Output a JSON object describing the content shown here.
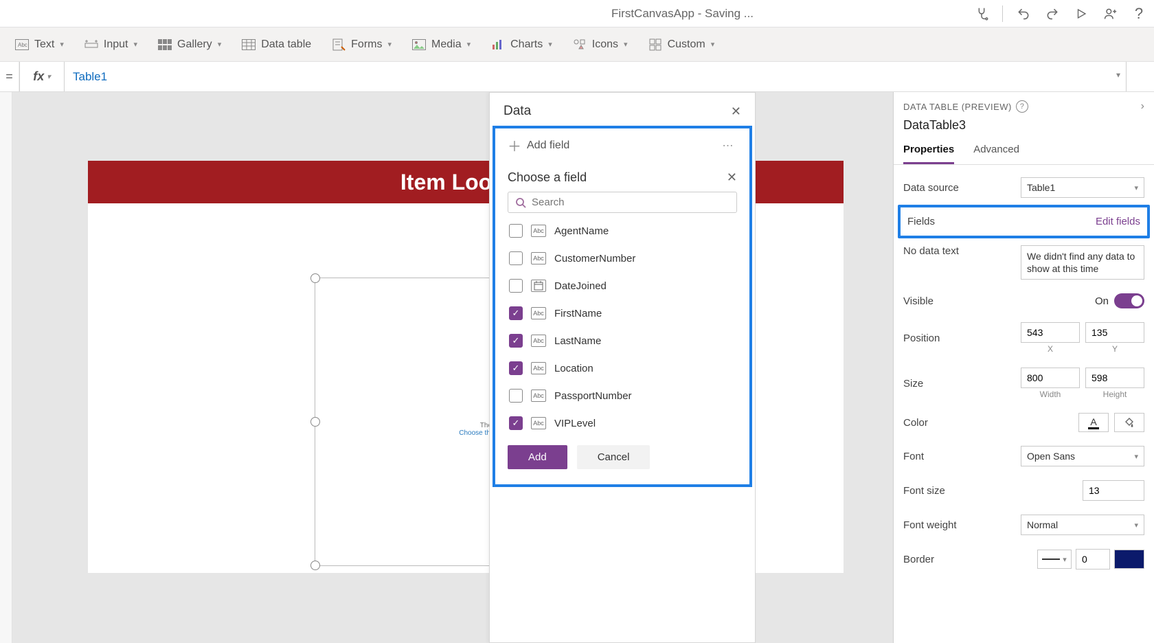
{
  "app": {
    "window_title": "FirstCanvasApp - Saving ..."
  },
  "ribbon": {
    "text": "Text",
    "input": "Input",
    "gallery": "Gallery",
    "datatable": "Data table",
    "forms": "Forms",
    "media": "Media",
    "charts": "Charts",
    "icons": "Icons",
    "custom": "Custom"
  },
  "formula": {
    "value": "Table1"
  },
  "canvas": {
    "header_title": "Item Lookup",
    "empty_line1": "There are no field",
    "empty_line2": "Choose the fields you want to a"
  },
  "data_panel": {
    "title": "Data",
    "add_field": "Add field",
    "choose_title": "Choose a field",
    "search_placeholder": "Search",
    "fields": [
      {
        "name": "AgentName",
        "type": "Abc",
        "checked": false,
        "icon": "abc"
      },
      {
        "name": "CustomerNumber",
        "type": "Abc",
        "checked": false,
        "icon": "abc"
      },
      {
        "name": "DateJoined",
        "type": "Date",
        "checked": false,
        "icon": "date"
      },
      {
        "name": "FirstName",
        "type": "Abc",
        "checked": true,
        "icon": "abc"
      },
      {
        "name": "LastName",
        "type": "Abc",
        "checked": true,
        "icon": "abc"
      },
      {
        "name": "Location",
        "type": "Abc",
        "checked": true,
        "icon": "abc"
      },
      {
        "name": "PassportNumber",
        "type": "Abc",
        "checked": false,
        "icon": "abc"
      },
      {
        "name": "VIPLevel",
        "type": "Abc",
        "checked": true,
        "icon": "abc"
      }
    ],
    "add_btn": "Add",
    "cancel_btn": "Cancel"
  },
  "properties": {
    "category": "DATA TABLE (PREVIEW)",
    "control_name": "DataTable3",
    "tabs": {
      "properties": "Properties",
      "advanced": "Advanced"
    },
    "data_source": {
      "label": "Data source",
      "value": "Table1"
    },
    "fields": {
      "label": "Fields",
      "link": "Edit fields"
    },
    "nodata": {
      "label": "No data text",
      "value": "We didn't find any data to show at this time"
    },
    "visible": {
      "label": "Visible",
      "state": "On"
    },
    "position": {
      "label": "Position",
      "x": "543",
      "y": "135",
      "xl": "X",
      "yl": "Y"
    },
    "size": {
      "label": "Size",
      "w": "800",
      "h": "598",
      "wl": "Width",
      "hl": "Height"
    },
    "color": {
      "label": "Color",
      "char": "A"
    },
    "font": {
      "label": "Font",
      "value": "Open Sans"
    },
    "fontsize": {
      "label": "Font size",
      "value": "13"
    },
    "fontweight": {
      "label": "Font weight",
      "value": "Normal"
    },
    "border": {
      "label": "Border",
      "width": "0"
    }
  }
}
